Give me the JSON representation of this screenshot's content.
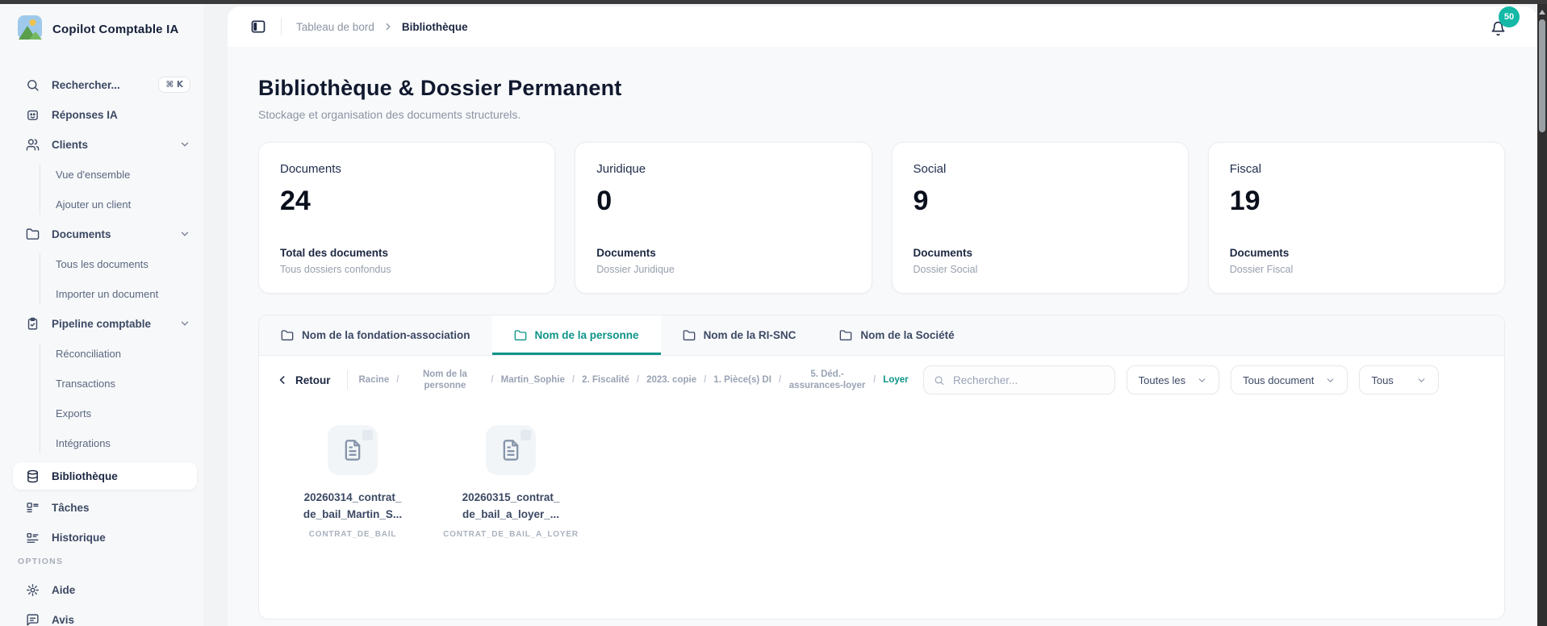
{
  "app": {
    "name": "Copilot Comptable IA"
  },
  "topbar": {
    "breadcrumb": {
      "parent": "Tableau de bord",
      "current": "Bibliothèque"
    },
    "notification_count": "50"
  },
  "sidebar": {
    "search_label": "Rechercher...",
    "search_shortcut": "⌘ K",
    "answers_label": "Réponses IA",
    "groups": [
      {
        "label": "Clients",
        "children": [
          "Vue d'ensemble",
          "Ajouter un client"
        ]
      },
      {
        "label": "Documents",
        "children": [
          "Tous les documents",
          "Importer un document"
        ]
      },
      {
        "label": "Pipeline comptable",
        "children": [
          "Réconciliation",
          "Transactions",
          "Exports",
          "Intégrations"
        ]
      }
    ],
    "library_label": "Bibliothèque",
    "tasks_label": "Tâches",
    "history_label": "Historique",
    "options_label": "OPTIONS",
    "help_label": "Aide",
    "feedback_label": "Avis"
  },
  "page": {
    "title": "Bibliothèque & Dossier Permanent",
    "subtitle": "Stockage et organisation des documents structurels."
  },
  "stats": [
    {
      "title": "Documents",
      "value": "24",
      "label": "Total des documents",
      "sublabel": "Tous dossiers confondus"
    },
    {
      "title": "Juridique",
      "value": "0",
      "label": "Documents",
      "sublabel": "Dossier Juridique"
    },
    {
      "title": "Social",
      "value": "9",
      "label": "Documents",
      "sublabel": "Dossier Social"
    },
    {
      "title": "Fiscal",
      "value": "19",
      "label": "Documents",
      "sublabel": "Dossier Fiscal"
    }
  ],
  "tabs": [
    {
      "label": "Nom de la fondation-association"
    },
    {
      "label": "Nom de la personne"
    },
    {
      "label": "Nom de la RI-SNC"
    },
    {
      "label": "Nom de la Société"
    }
  ],
  "browser": {
    "back_label": "Retour",
    "sep": "/",
    "path": [
      "Racine",
      "Nom de la personne",
      "Martin_Sophie",
      "2. Fiscalité",
      "2023. copie",
      "1. Pièce(s) DI",
      "5. Déd.-assurances-loyer"
    ],
    "current": "Loyer",
    "search_placeholder": "Rechercher...",
    "filters": [
      {
        "label": "Toutes les"
      },
      {
        "label": "Tous document"
      },
      {
        "label": "Tous"
      }
    ],
    "files": [
      {
        "line1": "20260314_contrat_",
        "line2": "de_bail_Martin_S...",
        "tag": "CONTRAT_DE_BAIL"
      },
      {
        "line1": "20260315_contrat_",
        "line2": "de_bail_a_loyer_...",
        "tag": "CONTRAT_DE_BAIL_A_LOYER"
      }
    ]
  },
  "colors": {
    "accent": "#0d9488",
    "badge": "#14b8a6"
  }
}
